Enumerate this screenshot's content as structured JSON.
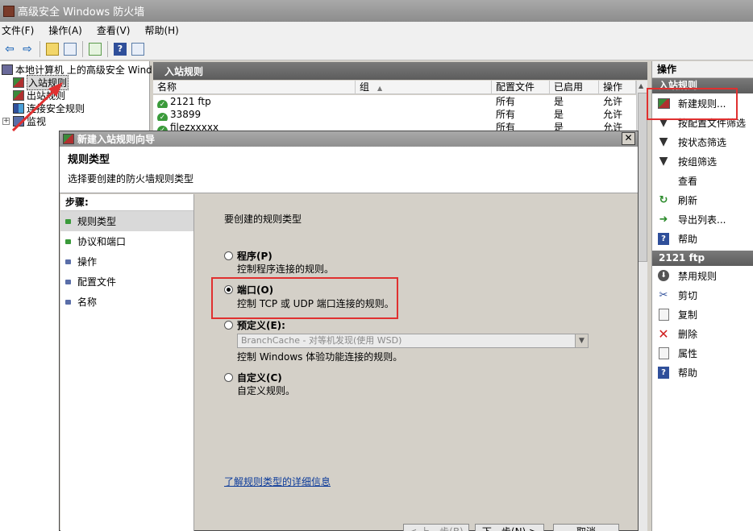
{
  "window": {
    "title": "高级安全 Windows 防火墙"
  },
  "menu": [
    "文件(F)",
    "操作(A)",
    "查看(V)",
    "帮助(H)"
  ],
  "tree": {
    "root": "本地计算机 上的高级安全 Wind",
    "items": [
      "入站规则",
      "出站规则",
      "连接安全规则",
      "监视"
    ]
  },
  "center": {
    "title": "入站规则",
    "columns": [
      "名称",
      "组",
      "配置文件",
      "已启用",
      "操作"
    ],
    "rows": [
      {
        "name": "2121 ftp",
        "group": "",
        "profile": "所有",
        "enabled": "是",
        "action": "允许"
      },
      {
        "name": "33899",
        "group": "",
        "profile": "所有",
        "enabled": "是",
        "action": "允许"
      },
      {
        "name": "filezxxxxx",
        "group": "",
        "profile": "所有",
        "enabled": "是",
        "action": "允许"
      }
    ]
  },
  "actions": {
    "header": "操作",
    "section1": "入站规则",
    "items1": [
      "新建规则...",
      "按配置文件筛选",
      "按状态筛选",
      "按组筛选",
      "查看",
      "刷新",
      "导出列表...",
      "帮助"
    ],
    "section2": "2121 ftp",
    "items2": [
      "禁用规则",
      "剪切",
      "复制",
      "删除",
      "属性",
      "帮助"
    ]
  },
  "dialog": {
    "title": "新建入站规则向导",
    "heading": "规则类型",
    "subheading": "选择要创建的防火墙规则类型",
    "steps_label": "步骤:",
    "steps": [
      "规则类型",
      "协议和端口",
      "操作",
      "配置文件",
      "名称"
    ],
    "question": "要创建的规则类型",
    "options": [
      {
        "label": "程序(P)",
        "desc": "控制程序连接的规则。",
        "selected": false
      },
      {
        "label": "端口(O)",
        "desc": "控制 TCP 或 UDP 端口连接的规则。",
        "selected": true
      },
      {
        "label": "预定义(E):",
        "desc": "控制 Windows 体验功能连接的规则。",
        "selected": false
      },
      {
        "label": "自定义(C)",
        "desc": "自定义规则。",
        "selected": false
      }
    ],
    "predefined_value": "BranchCache - 对等机发现(使用 WSD)",
    "learn_more": "了解规则类型的详细信息",
    "buttons": {
      "back": "< 上一步(B)",
      "next": "下一步(N) >",
      "cancel": "取消"
    }
  },
  "colors": {
    "annotation": "#e03030",
    "header_dark": "#5c5c5c"
  }
}
